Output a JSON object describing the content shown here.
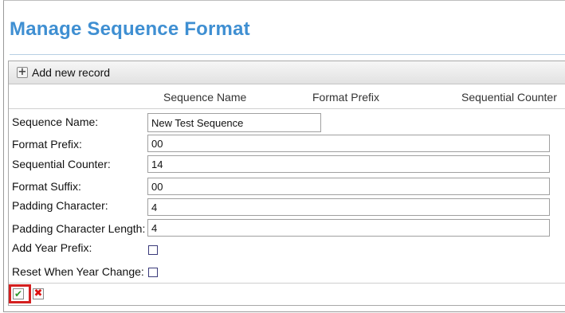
{
  "page": {
    "title": "Manage Sequence Format"
  },
  "toolbar": {
    "add_label": "Add new record",
    "add_icon": "plus-icon"
  },
  "columns": [
    "Sequence Name",
    "Format Prefix",
    "Sequential Counter"
  ],
  "form": {
    "sequence_name_label": "Sequence Name:",
    "sequence_name_value": "New Test Sequence",
    "format_prefix_label": "Format Prefix:",
    "format_prefix_value": "00",
    "sequential_counter_label": "Sequential Counter:",
    "sequential_counter_value": "14",
    "format_suffix_label": "Format Suffix:",
    "format_suffix_value": "00",
    "padding_char_label": "Padding Character:",
    "padding_char_value": "4",
    "padding_len_label": "Padding Character Length:",
    "padding_len_value": "4",
    "add_year_prefix_label": "Add Year Prefix:",
    "add_year_prefix_checked": false,
    "reset_year_label": "Reset When Year Change:",
    "reset_year_checked": false
  },
  "actions": {
    "save_icon": "checkmark-icon",
    "cancel_icon": "close-icon"
  },
  "colors": {
    "title": "#3f8fd2",
    "highlight": "#d42020",
    "save": "#2e9a2e",
    "cancel": "#dd1111"
  }
}
